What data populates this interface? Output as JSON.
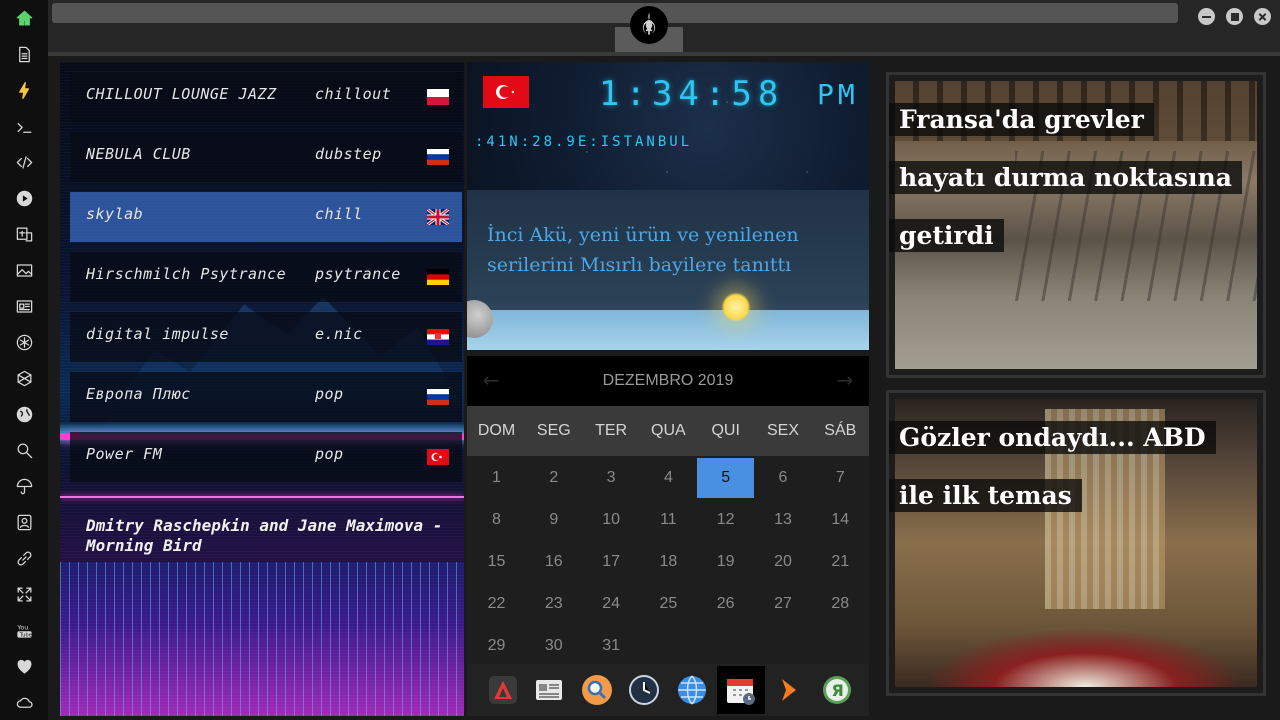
{
  "window": {
    "title_emblem": "rebel-alliance-emblem"
  },
  "sidebar": {
    "items": [
      {
        "name": "home-icon"
      },
      {
        "name": "document-icon"
      },
      {
        "name": "lightning-icon"
      },
      {
        "name": "terminal-icon"
      },
      {
        "name": "code-icon"
      },
      {
        "name": "play-icon"
      },
      {
        "name": "translate-icon"
      },
      {
        "name": "image-icon"
      },
      {
        "name": "newspaper-icon"
      },
      {
        "name": "asterisk-icon"
      },
      {
        "name": "hexagon-icon"
      },
      {
        "name": "globe-icon"
      },
      {
        "name": "search-icon"
      },
      {
        "name": "umbrella-icon"
      },
      {
        "name": "contact-card-icon"
      },
      {
        "name": "link-icon"
      },
      {
        "name": "expand-icon"
      },
      {
        "name": "youtube-icon"
      },
      {
        "name": "heart-icon"
      },
      {
        "name": "cloud-icon"
      }
    ]
  },
  "radio": {
    "stations": [
      {
        "name": "CHILLOUT LOUNGE JAZZ",
        "genre": "chillout",
        "flag": "poland",
        "active": false
      },
      {
        "name": "NEBULA CLUB",
        "genre": "dubstep",
        "flag": "russia",
        "active": false
      },
      {
        "name": "skylab",
        "genre": "chill",
        "flag": "uk",
        "active": true
      },
      {
        "name": "Hirschmilch Psytrance",
        "genre": "psytrance",
        "flag": "germany",
        "active": false
      },
      {
        "name": "digital impulse",
        "genre": "e.nic",
        "flag": "croatia",
        "active": false
      },
      {
        "name": "Европа Плюс",
        "genre": "pop",
        "flag": "russia",
        "active": false
      },
      {
        "name": "Power FM",
        "genre": "pop",
        "flag": "turkey",
        "active": false
      }
    ],
    "now_playing": "Dmitry Raschepkin and Jane Maximova - Morning Bird"
  },
  "clock": {
    "flag": "turkey",
    "time": "1:34:58",
    "ampm": "PM",
    "location": ":41N:28.9E:ISTANBUL"
  },
  "weather": {
    "headline": "İnci Akü, yeni ürün ve yenilenen serilerini Mısırlı bayilere tanıttı"
  },
  "calendar": {
    "month": "DEZEMBRO 2019",
    "prev_icon": "chevron-left-icon",
    "next_icon": "chevron-right-icon",
    "weekdays": [
      "DOM",
      "SEG",
      "TER",
      "QUA",
      "QUI",
      "SEX",
      "SÁB"
    ],
    "first_weekday_index": 0,
    "days_in_month": 31,
    "today": 5
  },
  "dock": {
    "items": [
      {
        "name": "app-launcher-icon",
        "selected": false
      },
      {
        "name": "news-reader-icon",
        "selected": false
      },
      {
        "name": "search-app-icon",
        "selected": false
      },
      {
        "name": "clock-app-icon",
        "selected": false
      },
      {
        "name": "web-browser-icon",
        "selected": false
      },
      {
        "name": "calendar-app-icon",
        "selected": true
      },
      {
        "name": "media-player-icon",
        "selected": false
      },
      {
        "name": "yandex-icon",
        "selected": false
      }
    ]
  },
  "news": [
    {
      "lines": [
        "Fransa'da grevler",
        "hayatı durma noktasına",
        "getirdi"
      ]
    },
    {
      "lines": [
        "Gözler ondaydı... ABD",
        "ile ilk temas"
      ]
    }
  ],
  "colors": {
    "accent_cyan": "#2cc6f2",
    "calendar_today": "#4a90e2",
    "turkey_red": "#e30a17",
    "headline_blue": "#4aa8e8"
  }
}
